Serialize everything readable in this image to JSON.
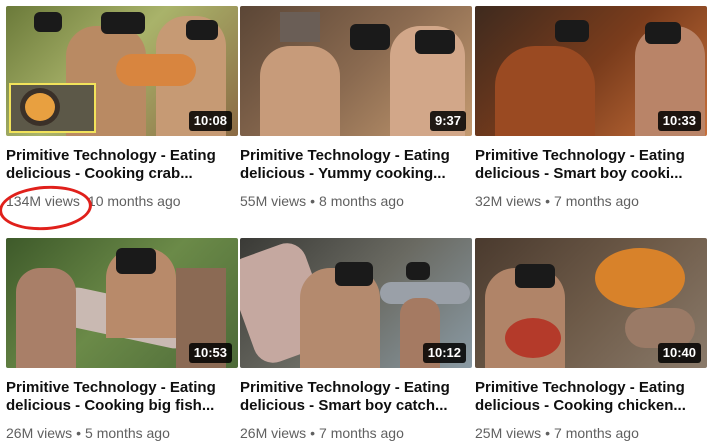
{
  "videos": [
    {
      "title_line1": "Primitive Technology - Eating",
      "title_line2": "delicious - Cooking crab...",
      "views": "134M views",
      "age": "10 months ago",
      "duration": "10:08",
      "thumb_colors": [
        "#6b7a3a",
        "#a9b36a",
        "#d8853f"
      ]
    },
    {
      "title_line1": "Primitive Technology - Eating",
      "title_line2": "delicious - Yummy cooking...",
      "views": "55M views",
      "age": "8 months ago",
      "duration": "9:37",
      "thumb_colors": [
        "#7a5a3e",
        "#c79b7a",
        "#e0a070"
      ]
    },
    {
      "title_line1": "Primitive Technology - Eating",
      "title_line2": "delicious - Smart boy cooki...",
      "views": "32M views",
      "age": "7 months ago",
      "duration": "10:33",
      "thumb_colors": [
        "#5a3c2a",
        "#9a4a22",
        "#c8703a"
      ]
    },
    {
      "title_line1": "Primitive Technology - Eating",
      "title_line2": "delicious - Cooking big fish...",
      "views": "26M views",
      "age": "5 months ago",
      "duration": "10:53",
      "thumb_colors": [
        "#4d6a38",
        "#c9b9b2",
        "#a97f68"
      ]
    },
    {
      "title_line1": "Primitive Technology - Eating",
      "title_line2": "delicious - Smart boy catch...",
      "views": "26M views",
      "age": "7 months ago",
      "duration": "10:12",
      "thumb_colors": [
        "#5a5048",
        "#b8aea6",
        "#9aa0a8"
      ]
    },
    {
      "title_line1": "Primitive Technology - Eating",
      "title_line2": "delicious - Cooking chicken...",
      "views": "25M views",
      "age": "7 months ago",
      "duration": "10:40",
      "thumb_colors": [
        "#6d5a48",
        "#d8822a",
        "#b43a2a"
      ]
    }
  ],
  "separator": "•",
  "highlight_color": "#e0201b"
}
